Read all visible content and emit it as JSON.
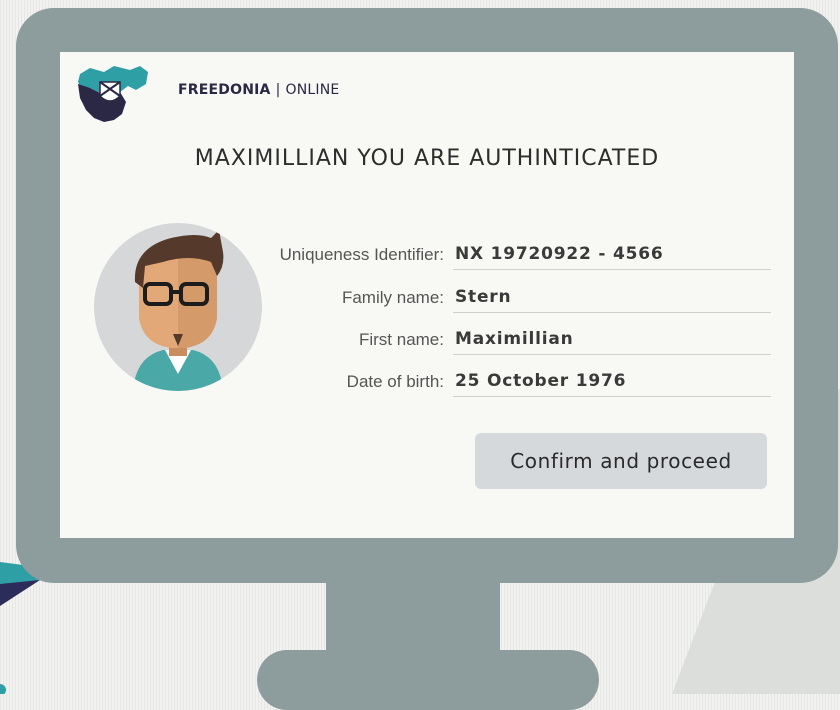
{
  "brand": {
    "name": "FREEDONIA",
    "separator": "|",
    "section": "ONLINE",
    "logo_icon": "freedonia-map-logo-icon"
  },
  "title": "MAXIMILLIAN YOU ARE AUTHINTICATED",
  "avatar": {
    "icon": "user-avatar-icon"
  },
  "fields": [
    {
      "label": "Uniqueness Identifier:",
      "value": "NX 19720922 - 4566"
    },
    {
      "label": "Family name:",
      "value": "Stern"
    },
    {
      "label": "First name:",
      "value": "Maximillian"
    },
    {
      "label": "Date of birth:",
      "value": "25 October 1976"
    }
  ],
  "confirm_button": {
    "label": "Confirm and proceed"
  },
  "colors": {
    "monitor": "#8d9c9d",
    "screen": "#f8f8f5",
    "button": "#d6d9dc",
    "brand_navy": "#2a2845",
    "brand_teal": "#2f9fa6"
  }
}
